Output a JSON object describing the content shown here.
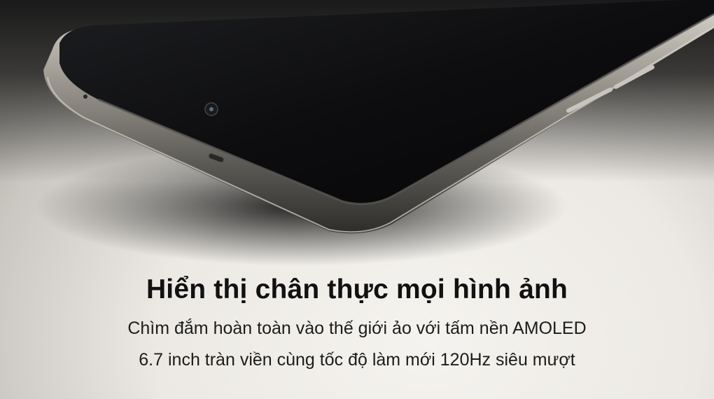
{
  "banner": {
    "headline": "Hiển thị chân thực mọi hình ảnh",
    "subline_1": "Chìm đắm hoàn toàn vào thế giới ảo với tấm nền AMOLED",
    "subline_2": "6.7 inch tràn viền cùng tốc độ làm mới 120Hz siêu mượt"
  },
  "colors": {
    "background_light": "#ece9e4",
    "screen_black": "#0b0b0c",
    "frame_metal": "#8a8780",
    "text": "#111111"
  }
}
